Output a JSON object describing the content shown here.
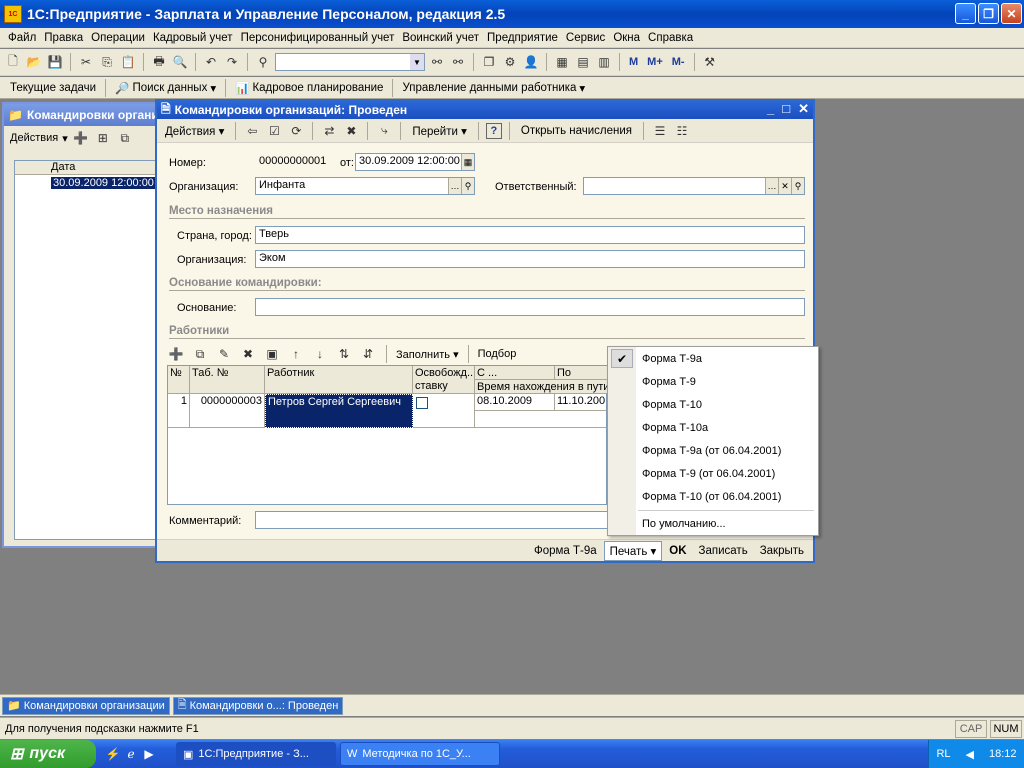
{
  "app": {
    "title": "1С:Предприятие - Зарплата и Управление Персоналом, редакция 2.5",
    "icon_text": "1С v8"
  },
  "menubar": [
    "Файл",
    "Правка",
    "Операции",
    "Кадровый учет",
    "Персонифицированный учет",
    "Воинский учет",
    "Предприятие",
    "Сервис",
    "Окна",
    "Справка"
  ],
  "toolbar1": {
    "m_buttons": [
      "M",
      "M+",
      "M-"
    ]
  },
  "toolbar2": [
    "Текущие задачи",
    "Поиск данных",
    "Кадровое планирование",
    "Управление данными работника"
  ],
  "bg_window": {
    "title": "Командировки органи",
    "actions": "Действия",
    "col_date": "Дата",
    "row_date": "30.09.2009 12:00:00"
  },
  "dialog": {
    "title": "Командировки организаций: Проведен",
    "toolbar": {
      "actions": "Действия",
      "goto": "Перейти",
      "help": "?",
      "open_accruals": "Открыть начисления"
    },
    "number_label": "Номер:",
    "number_value": "00000000001",
    "from_label": "от:",
    "date_value": "30.09.2009 12:00:00",
    "org_label": "Организация:",
    "org_value": "Инфанта",
    "resp_label": "Ответственный:",
    "resp_value": "",
    "dest_section": "Место назначения",
    "country_label": "Страна, город:",
    "country_value": "Тверь",
    "dest_org_label": "Организация:",
    "dest_org_value": "Эком",
    "reason_section": "Основание командировки:",
    "reason_label": "Основание:",
    "reason_value": "",
    "workers_section": "Работники",
    "workers_fill": "Заполнить",
    "workers_select": "Подбор",
    "grid": {
      "headers": [
        "№",
        "Таб. №",
        "Работник",
        "Освобожд... ставку",
        "С ...",
        "По"
      ],
      "subheader": "Время нахождения в пути",
      "rows": [
        {
          "num": "1",
          "tab": "0000000003",
          "worker": "Петров Сергей Сергеевич",
          "from": "08.10.2009",
          "to": "11.10.200"
        }
      ]
    },
    "comment_label": "Комментарий:",
    "comment_value": "",
    "footer": {
      "form": "Форма Т-9а",
      "print": "Печать",
      "ok": "OK",
      "save": "Записать",
      "close": "Закрыть"
    }
  },
  "print_menu": {
    "items": [
      "Форма Т-9а",
      "Форма Т-9",
      "Форма Т-10",
      "Форма Т-10а",
      "Форма Т-9а (от 06.04.2001)",
      "Форма Т-9 (от 06.04.2001)",
      "Форма Т-10 (от 06.04.2001)"
    ],
    "default": "По умолчанию...",
    "checked": "Форма Т-9а"
  },
  "mdi_tabs": [
    "Командировки организации",
    "Командировки о...: Проведен"
  ],
  "status": {
    "hint": "Для получения подсказки нажмите F1",
    "cap": "CAP",
    "num": "NUM"
  },
  "taskbar": {
    "start": "пуск",
    "buttons": [
      "1С:Предприятие - З...",
      "Методичка по 1С_У..."
    ],
    "lang": "RL",
    "time": "18:12"
  }
}
